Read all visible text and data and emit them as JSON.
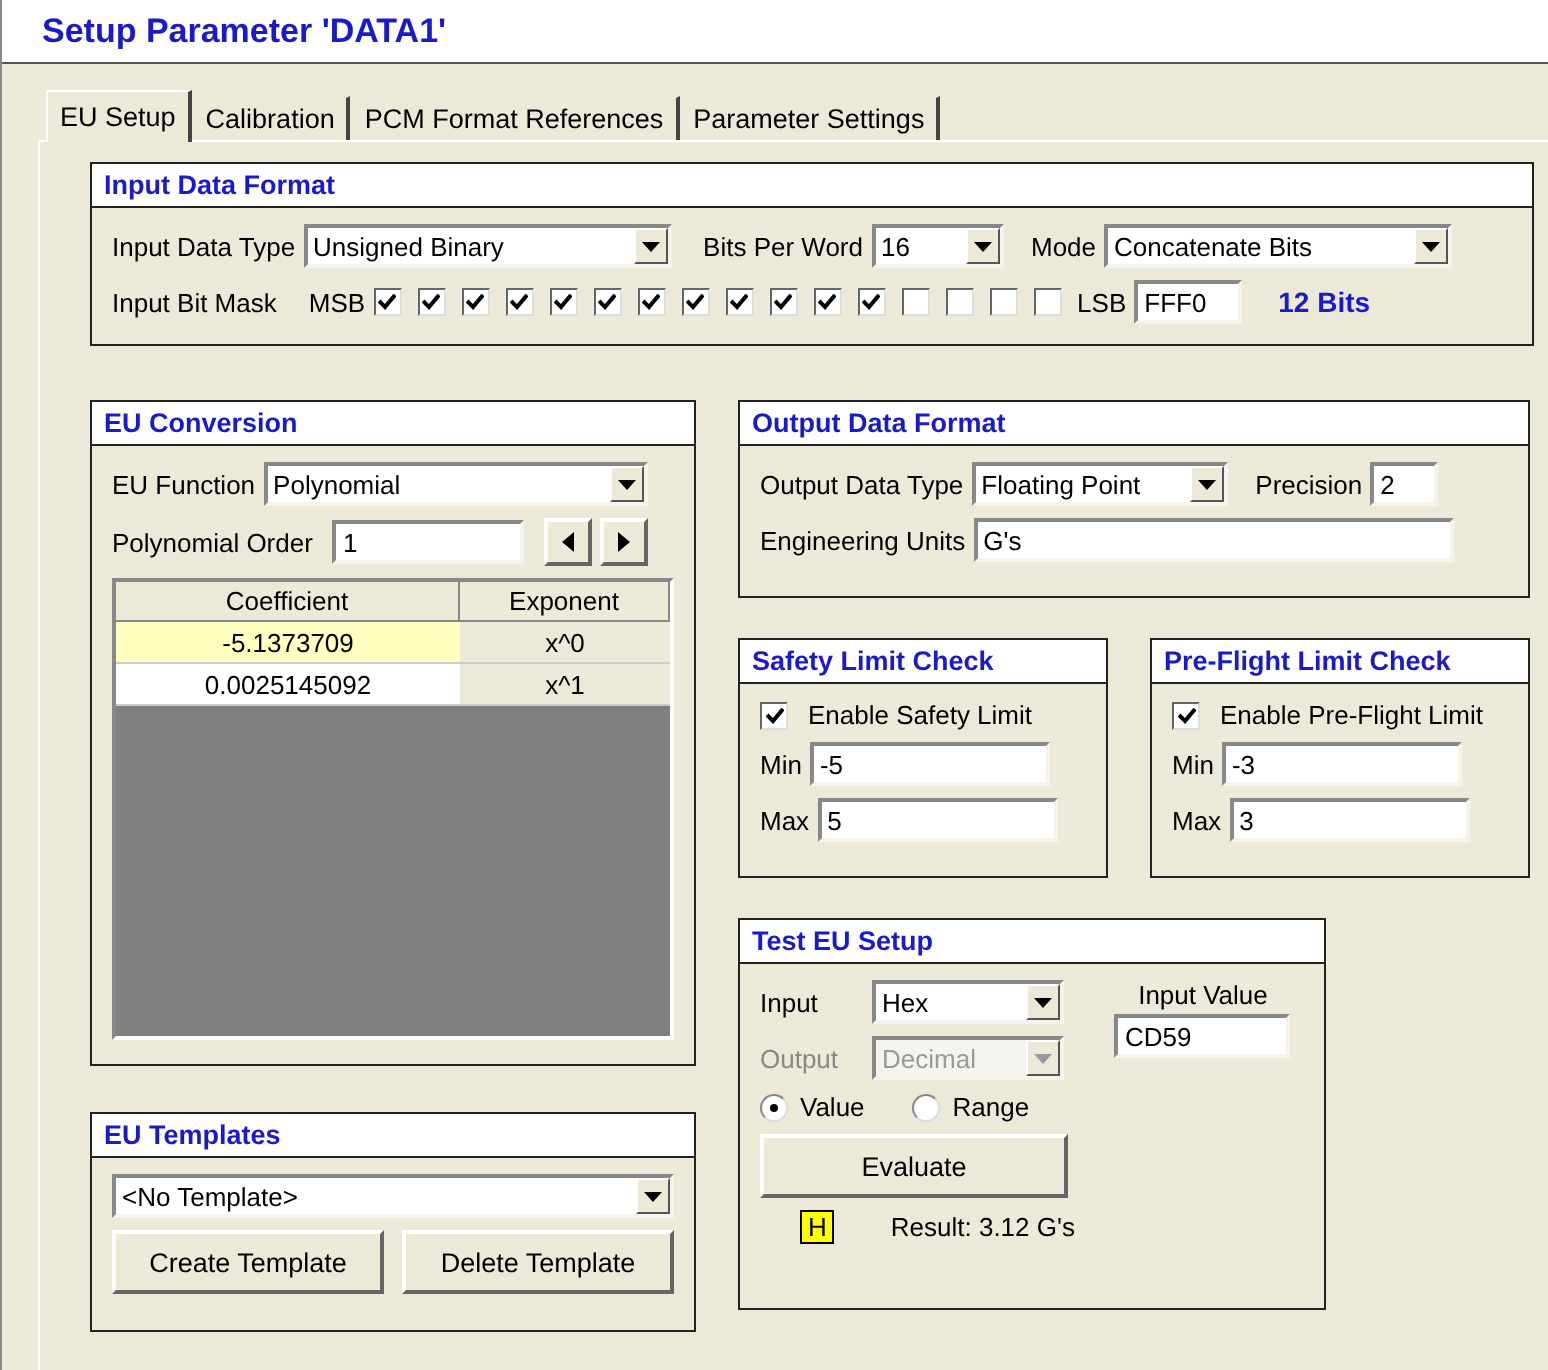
{
  "title": "Setup Parameter 'DATA1'",
  "tabs": [
    {
      "label": "EU Setup",
      "selected": true
    },
    {
      "label": "Calibration",
      "selected": false
    },
    {
      "label": "PCM Format References",
      "selected": false
    },
    {
      "label": "Parameter Settings",
      "selected": false
    }
  ],
  "input_data_format": {
    "title": "Input Data Format",
    "input_data_type": {
      "label": "Input Data Type",
      "value": "Unsigned Binary"
    },
    "bits_per_word": {
      "label": "Bits Per Word",
      "value": "16"
    },
    "mode": {
      "label": "Mode",
      "value": "Concatenate Bits"
    },
    "bit_mask": {
      "label": "Input Bit Mask",
      "msb_label": "MSB",
      "lsb_label": "LSB",
      "hex": "FFF0",
      "bit_count": "12 Bits",
      "bits": [
        {
          "checked": true
        },
        {
          "checked": true
        },
        {
          "checked": true
        },
        {
          "checked": true
        },
        {
          "checked": true
        },
        {
          "checked": true
        },
        {
          "checked": true
        },
        {
          "checked": true
        },
        {
          "checked": true
        },
        {
          "checked": true
        },
        {
          "checked": true
        },
        {
          "checked": true
        },
        {
          "checked": false
        },
        {
          "checked": false
        },
        {
          "checked": false
        },
        {
          "checked": false
        }
      ]
    }
  },
  "eu_conversion": {
    "title": "EU Conversion",
    "eu_function": {
      "label": "EU Function",
      "value": "Polynomial"
    },
    "polynomial_order": {
      "label": "Polynomial Order",
      "value": "1"
    },
    "table": {
      "columns": [
        "Coefficient",
        "Exponent"
      ],
      "rows": [
        {
          "coefficient": "-5.1373709",
          "exponent": "x^0",
          "selected": true
        },
        {
          "coefficient": "0.0025145092",
          "exponent": "x^1",
          "selected": false
        }
      ]
    }
  },
  "eu_templates": {
    "title": "EU Templates",
    "template": "<No Template>",
    "buttons": [
      "Create Template",
      "Delete Template"
    ]
  },
  "output_data_format": {
    "title": "Output Data Format",
    "output_data_type": {
      "label": "Output Data Type",
      "value": "Floating Point"
    },
    "precision": {
      "label": "Precision",
      "value": "2"
    },
    "engineering_units": {
      "label": "Engineering Units",
      "value": "G's"
    }
  },
  "limits": [
    {
      "title": "Safety Limit Check",
      "enable": {
        "label": "Enable Safety Limit",
        "checked": true
      },
      "min": {
        "label": "Min",
        "value": "-5"
      },
      "max": {
        "label": "Max",
        "value": "5"
      }
    },
    {
      "title": "Pre-Flight Limit Check",
      "enable": {
        "label": "Enable Pre-Flight Limit",
        "checked": true
      },
      "min": {
        "label": "Min",
        "value": "-3"
      },
      "max": {
        "label": "Max",
        "value": "3"
      }
    }
  ],
  "test_eu_setup": {
    "title": "Test EU Setup",
    "input": {
      "label": "Input",
      "value": "Hex",
      "disabled": false
    },
    "output": {
      "label": "Output",
      "value": "Decimal",
      "disabled": true
    },
    "input_value": {
      "label": "Input Value",
      "value": "CD59"
    },
    "modes": [
      {
        "label": "Value",
        "selected": true
      },
      {
        "label": "Range",
        "selected": false
      }
    ],
    "evaluate": "Evaluate",
    "flag": "H",
    "result": "Result: 3.12 G's"
  }
}
